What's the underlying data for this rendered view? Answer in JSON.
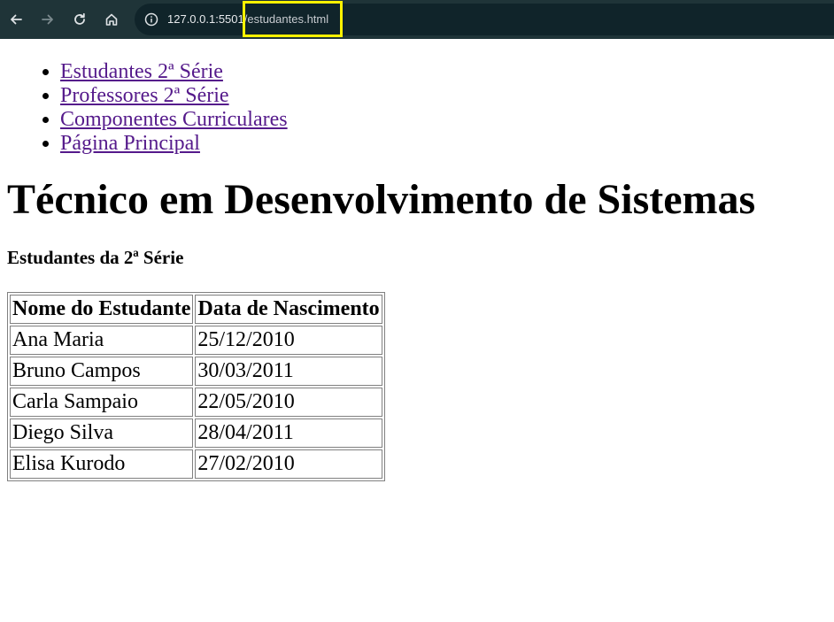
{
  "browser": {
    "url_host": "127.0.0.1:5501",
    "url_path": "/estudantes.html",
    "highlight_color": "#fff200"
  },
  "nav": {
    "items": [
      {
        "label": "Estudantes 2ª Série"
      },
      {
        "label": "Professores 2ª Série"
      },
      {
        "label": "Componentes Curriculares"
      },
      {
        "label": "Página Principal"
      }
    ]
  },
  "main": {
    "title": "Técnico em Desenvolvimento de Sistemas",
    "subtitle": "Estudantes da 2ª Série",
    "table": {
      "headers": [
        "Nome do Estudante",
        "Data de Nascimento"
      ],
      "rows": [
        [
          "Ana Maria",
          "25/12/2010"
        ],
        [
          "Bruno Campos",
          "30/03/2011"
        ],
        [
          "Carla Sampaio",
          "22/05/2010"
        ],
        [
          "Diego Silva",
          "28/04/2011"
        ],
        [
          "Elisa Kurodo",
          "27/02/2010"
        ]
      ]
    }
  },
  "colors": {
    "link_visited": "#551a8b",
    "toolbar_bg": "#1f3438"
  },
  "icons": [
    "back-arrow-icon",
    "forward-arrow-icon",
    "reload-icon",
    "home-icon",
    "info-icon"
  ]
}
